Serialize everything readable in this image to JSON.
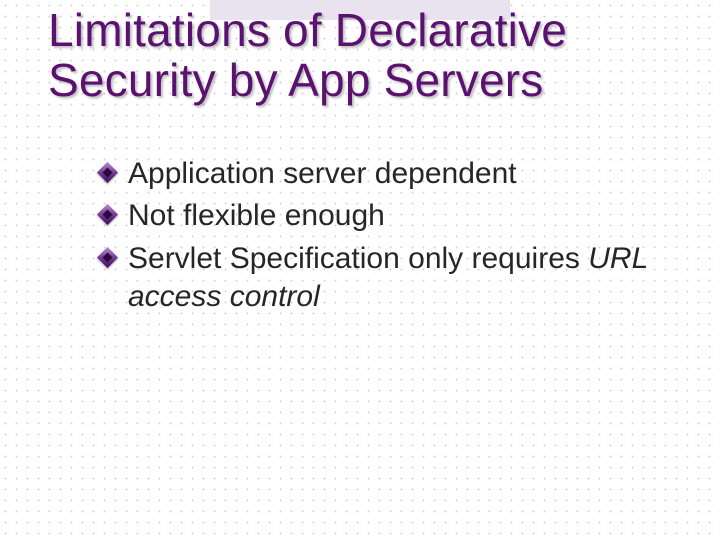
{
  "title": "Limitations of Declarative Security by App Servers",
  "bullets": [
    {
      "plain": "Application server dependent",
      "emph": ""
    },
    {
      "plain": "Not flexible enough",
      "emph": ""
    },
    {
      "plain": "Servlet Specification only requires ",
      "emph": "URL access control"
    }
  ]
}
